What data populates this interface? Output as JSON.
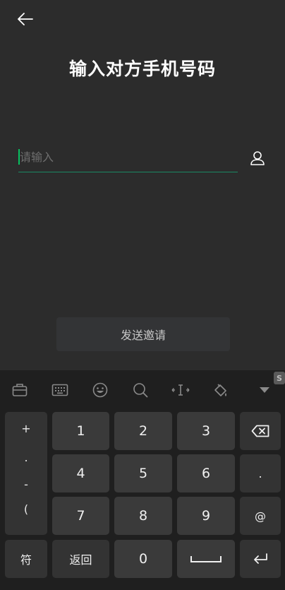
{
  "header": {
    "title": "输入对方手机号码"
  },
  "form": {
    "phone_placeholder": "请输入",
    "phone_value": ""
  },
  "actions": {
    "send_label": "发送邀请"
  },
  "keyboard": {
    "brand": "S",
    "symbols": [
      "+",
      ".",
      "-",
      "("
    ],
    "digits": [
      "1",
      "2",
      "3",
      "4",
      "5",
      "6",
      "7",
      "8",
      "9",
      "0"
    ],
    "dot": ".",
    "at": "@",
    "symbol_key": "符",
    "back_key": "返回"
  },
  "colors": {
    "accent": "#07c160",
    "background": "#2c2c2c",
    "keyboard_bg": "#1f1f1f",
    "key_bg": "#3a3a3a"
  }
}
